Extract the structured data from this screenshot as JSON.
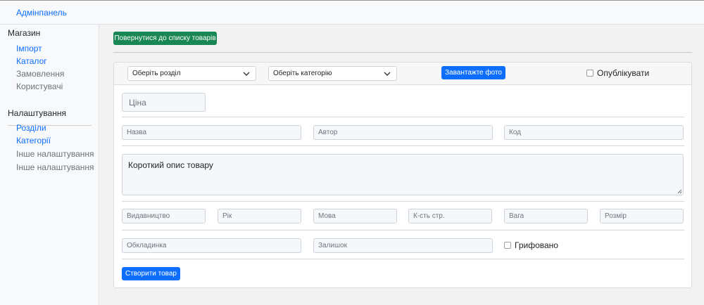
{
  "app": {
    "brand": "Адмінпанель"
  },
  "sidebar": {
    "sections": [
      {
        "title": "Магазин",
        "items": [
          {
            "label": "Імпорт",
            "active": true
          },
          {
            "label": "Каталог",
            "active": true
          },
          {
            "label": "Замовлення",
            "active": false
          },
          {
            "label": "Користувачі",
            "active": false
          }
        ]
      },
      {
        "title": "Налаштування",
        "items": [
          {
            "label": "Розділи",
            "active": true
          },
          {
            "label": "Категорії",
            "active": true
          },
          {
            "label": "Інше налаштування",
            "active": false
          },
          {
            "label": "Інше налаштування",
            "active": false
          }
        ]
      }
    ]
  },
  "toolbar": {
    "back_label": "Повернутися до списку товарів"
  },
  "form": {
    "header": {
      "section_select": "Оберіть розділ",
      "category_select": "Оберіть категорію",
      "upload_label": "Завантажте фото",
      "published_label": "Опублікувати",
      "published_checked": false
    },
    "price_placeholder": "Ціна",
    "name_placeholder": "Назва",
    "author_placeholder": "Автор",
    "code_placeholder": "Код",
    "short_description": "Короткий опис товару",
    "publisher_placeholder": "Видавництво",
    "year_placeholder": "Рік",
    "language_placeholder": "Мова",
    "pages_placeholder": "К-сть стр.",
    "weight_placeholder": "Вага",
    "size_placeholder": "Розмір",
    "cover_placeholder": "Обкладинка",
    "stock_placeholder": "Залишок",
    "stamped_label": "Грифовано",
    "stamped_checked": false,
    "submit_label": "Створити товар"
  },
  "colors": {
    "primary": "#0d6efd",
    "success": "#198754",
    "muted": "#6c757d"
  }
}
